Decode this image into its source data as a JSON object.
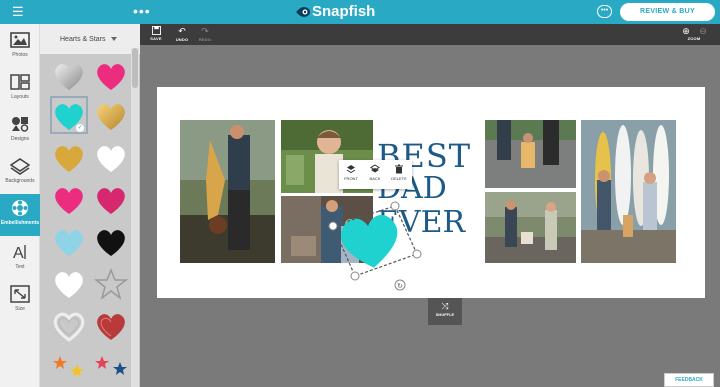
{
  "app": {
    "brand": "Snapfish",
    "review_button": "REVIEW & BUY",
    "more": "•••"
  },
  "colors": {
    "accent": "#2aa9c4",
    "title_text": "#1d5a87",
    "selected_heart": "#1fd2cf"
  },
  "left_tools": [
    {
      "label": "Photos",
      "icon": "photos-icon"
    },
    {
      "label": "Layouts",
      "icon": "layouts-icon"
    },
    {
      "label": "Designs",
      "icon": "designs-icon"
    },
    {
      "label": "Backgrounds",
      "icon": "backgrounds-icon"
    },
    {
      "label": "Embellishments",
      "icon": "embellishments-icon",
      "active": true
    },
    {
      "label": "Text",
      "icon": "text-icon"
    },
    {
      "label": "Size",
      "icon": "size-icon"
    }
  ],
  "panel": {
    "category": "Hearts & Stars",
    "stickers": [
      "silver heart",
      "pink heart",
      "teal heart",
      "gold heart",
      "gold heart",
      "white heart",
      "pink heart",
      "magenta heart",
      "light blue heart",
      "black heart",
      "white heart",
      "star outline",
      "silver outline heart",
      "red glitter heart",
      "colored stars",
      "colored stars"
    ]
  },
  "toolbar": {
    "save": "SAVE",
    "undo": "UNDO",
    "redo": "REDO",
    "zoom": "ZOOM"
  },
  "canvas": {
    "title_line1": "BEST",
    "title_line2": "DAD",
    "title_line3": "EVER"
  },
  "context_menu": {
    "front": "FRONT",
    "back": "BACK",
    "delete": "DELETE"
  },
  "shuffle": "SHUFFLE",
  "feedback": "FEEDBACK"
}
